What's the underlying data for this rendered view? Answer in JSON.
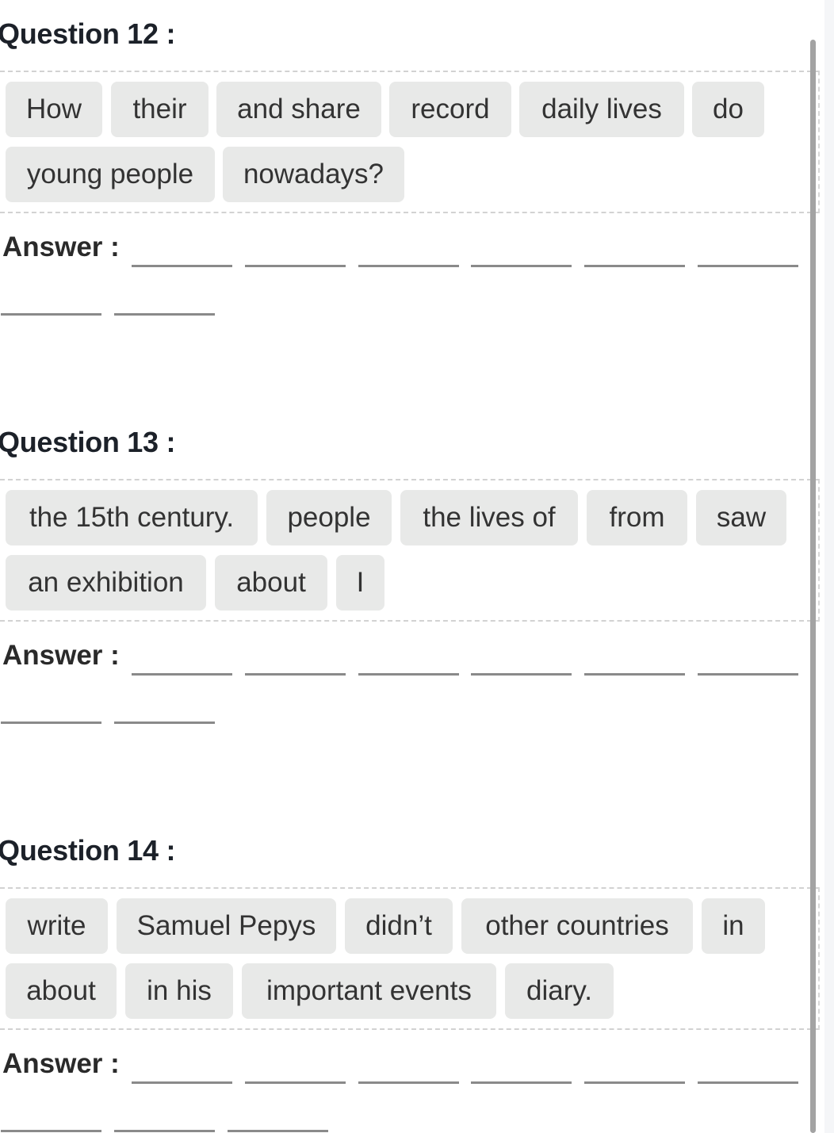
{
  "questions": [
    {
      "title": "Question 12 :",
      "chips": [
        "How",
        "their",
        "and share",
        "record",
        "daily lives",
        "do",
        "young people",
        "nowadays?"
      ],
      "answer_label": "Answer :",
      "blank_count": 8
    },
    {
      "title": "Question 13 :",
      "chips": [
        "the 15th century.",
        "people",
        "the lives of",
        "from",
        "saw",
        "an exhibition",
        "about",
        "I"
      ],
      "answer_label": "Answer :",
      "blank_count": 8
    },
    {
      "title": "Question 14 :",
      "chips": [
        "write",
        "Samuel Pepys",
        "didn’t",
        "other countries",
        "in",
        "about",
        "in his",
        "important events",
        "diary."
      ],
      "answer_label": "Answer :",
      "blank_count": 9
    }
  ]
}
